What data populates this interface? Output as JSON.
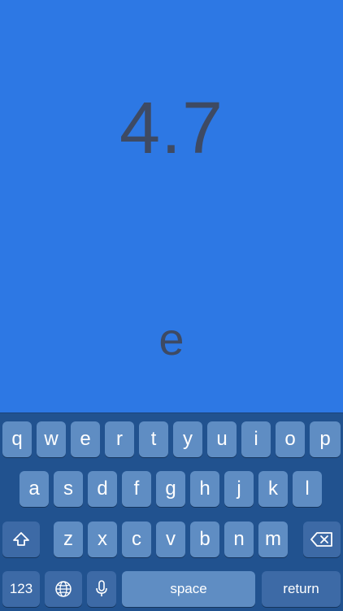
{
  "display": {
    "score": "4.7",
    "current_letter": "e"
  },
  "keyboard": {
    "row1": [
      "q",
      "w",
      "e",
      "r",
      "t",
      "y",
      "u",
      "i",
      "o",
      "p"
    ],
    "row2": [
      "a",
      "s",
      "d",
      "f",
      "g",
      "h",
      "j",
      "k",
      "l"
    ],
    "row3": [
      "z",
      "x",
      "c",
      "v",
      "b",
      "n",
      "m"
    ],
    "numbers_label": "123",
    "space_label": "space",
    "return_label": "return",
    "icons": {
      "shift": "shift-icon",
      "delete": "backspace-icon",
      "globe": "globe-icon",
      "mic": "microphone-icon"
    }
  },
  "colors": {
    "background": "#2d78e4",
    "display_text": "#3e4a63",
    "keyboard_bg": "#21528f",
    "key": "#5f8dc3",
    "function_key": "#3d6aa6"
  }
}
